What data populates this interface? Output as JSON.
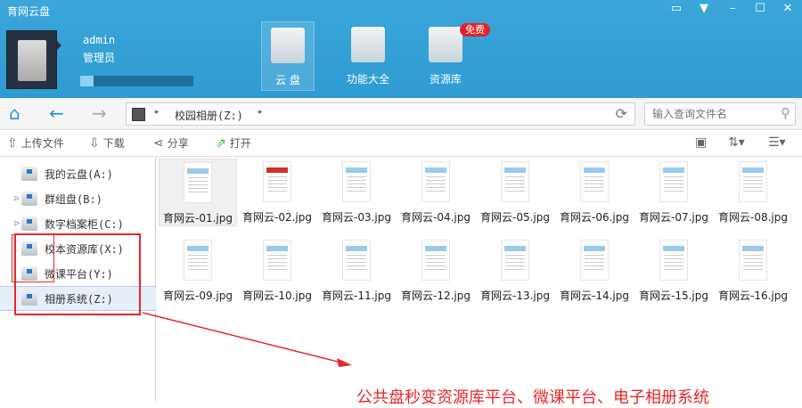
{
  "app": {
    "title": "育网云盘"
  },
  "window_controls": [
    "feedback-icon",
    "skin-icon",
    "minimize-icon",
    "maximize-icon",
    "close-icon"
  ],
  "user": {
    "name": "admin",
    "role": "管理员",
    "quota_used_fraction": 0.12
  },
  "nav_tiles": [
    {
      "label": "云 盘",
      "active": true
    },
    {
      "label": "功能大全",
      "active": false
    },
    {
      "label": "资源库",
      "active": false,
      "badge": "免费"
    }
  ],
  "path": {
    "current": "校园相册(Z:)"
  },
  "search": {
    "placeholder": "输入查询文件名"
  },
  "toolbar": {
    "upload": "上传文件",
    "download": "下载",
    "share": "分享",
    "open": "打开"
  },
  "sidebar": {
    "items": [
      {
        "label": "我的云盘(A:)",
        "expandable": false
      },
      {
        "label": "群组盘(B:)",
        "expandable": true
      },
      {
        "label": "数字档案柜(C:)",
        "expandable": true
      },
      {
        "label": "校本资源库(X:)",
        "expandable": false
      },
      {
        "label": "微课平台(Y:)",
        "expandable": false
      },
      {
        "label": "相册系统(Z:)",
        "expandable": false,
        "selected": true
      }
    ]
  },
  "files": [
    "育网云-01.jpg",
    "育网云-02.jpg",
    "育网云-03.jpg",
    "育网云-04.jpg",
    "育网云-05.jpg",
    "育网云-06.jpg",
    "育网云-07.jpg",
    "育网云-08.jpg",
    "育网云-09.jpg",
    "育网云-10.jpg",
    "育网云-11.jpg",
    "育网云-12.jpg",
    "育网云-13.jpg",
    "育网云-14.jpg",
    "育网云-15.jpg",
    "育网云-16.jpg"
  ],
  "annotation": {
    "caption": "公共盘秒变资源库平台、微课平台、电子相册系统",
    "color": "#e8262b"
  }
}
